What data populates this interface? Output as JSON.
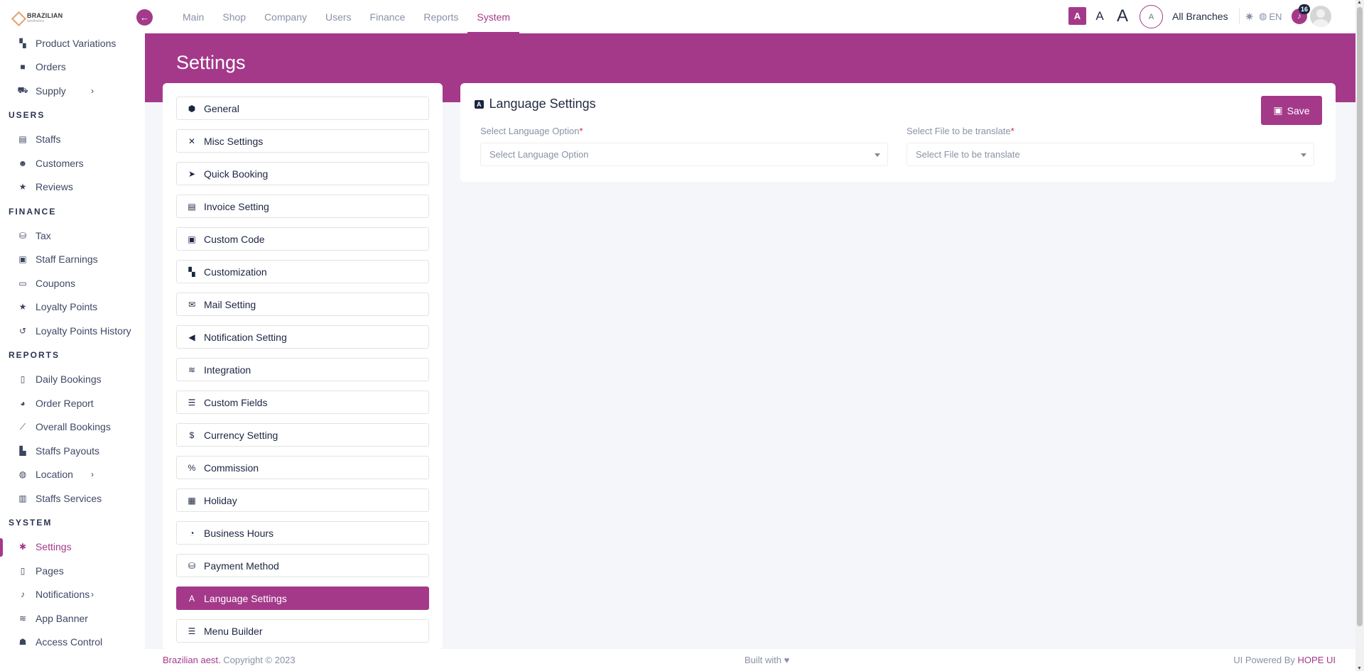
{
  "brand": {
    "name": "BRAZILIAN",
    "tagline": "aesthetics"
  },
  "sidebar": {
    "items": [
      {
        "type": "item",
        "label": "Product Variations",
        "icon": "product-variations-icon",
        "glyph": "▚"
      },
      {
        "type": "item",
        "label": "Orders",
        "icon": "shopping-bag-icon",
        "glyph": "■"
      },
      {
        "type": "item",
        "label": "Supply",
        "icon": "truck-icon",
        "glyph": "⛟",
        "chevron": true
      },
      {
        "type": "section",
        "label": "USERS"
      },
      {
        "type": "item",
        "label": "Staffs",
        "icon": "id-card-icon",
        "glyph": "▤"
      },
      {
        "type": "item",
        "label": "Customers",
        "icon": "users-icon",
        "glyph": "☻"
      },
      {
        "type": "item",
        "label": "Reviews",
        "icon": "star-icon",
        "glyph": "★"
      },
      {
        "type": "section",
        "label": "FINANCE"
      },
      {
        "type": "item",
        "label": "Tax",
        "icon": "tax-icon",
        "glyph": "⛁"
      },
      {
        "type": "item",
        "label": "Staff Earnings",
        "icon": "money-icon",
        "glyph": "▣"
      },
      {
        "type": "item",
        "label": "Coupons",
        "icon": "ticket-icon",
        "glyph": "▭"
      },
      {
        "type": "item",
        "label": "Loyalty Points",
        "icon": "star-icon",
        "glyph": "★"
      },
      {
        "type": "item",
        "label": "Loyalty Points History",
        "icon": "history-icon",
        "glyph": "↺"
      },
      {
        "type": "section",
        "label": "REPORTS"
      },
      {
        "type": "item",
        "label": "Daily Bookings",
        "icon": "file-icon",
        "glyph": "▯"
      },
      {
        "type": "item",
        "label": "Order Report",
        "icon": "pie-chart-icon",
        "glyph": "◕"
      },
      {
        "type": "item",
        "label": "Overall Bookings",
        "icon": "line-chart-icon",
        "glyph": "⟋"
      },
      {
        "type": "item",
        "label": "Staffs Payouts",
        "icon": "bar-chart-icon",
        "glyph": "▙"
      },
      {
        "type": "item",
        "label": "Location",
        "icon": "globe-icon",
        "glyph": "◍",
        "chevron": true
      },
      {
        "type": "item",
        "label": "Staffs Services",
        "icon": "clipboard-icon",
        "glyph": "▥"
      },
      {
        "type": "section",
        "label": "SYSTEM"
      },
      {
        "type": "item",
        "label": "Settings",
        "icon": "gear-icon",
        "glyph": "✱",
        "active": true
      },
      {
        "type": "item",
        "label": "Pages",
        "icon": "file-icon",
        "glyph": "▯"
      },
      {
        "type": "item",
        "label": "Notifications",
        "icon": "bell-icon",
        "glyph": "♪",
        "chevron": true
      },
      {
        "type": "item",
        "label": "App Banner",
        "icon": "sliders-icon",
        "glyph": "≋"
      },
      {
        "type": "item",
        "label": "Access Control",
        "icon": "user-lock-icon",
        "glyph": "☗"
      }
    ]
  },
  "topbar": {
    "menu": [
      {
        "label": "Main"
      },
      {
        "label": "Shop"
      },
      {
        "label": "Company"
      },
      {
        "label": "Users"
      },
      {
        "label": "Finance"
      },
      {
        "label": "Reports"
      },
      {
        "label": "System",
        "active": true
      }
    ],
    "font_small": "A",
    "font_medium": "A",
    "font_large": "A",
    "avatar_initial": "A",
    "branch": "All Branches",
    "language": "EN",
    "notification_count": "16"
  },
  "page": {
    "title": "Settings"
  },
  "settings_menu": [
    {
      "label": "General",
      "icon": "cube-icon",
      "glyph": "⬢"
    },
    {
      "label": "Misc Settings",
      "icon": "tools-icon",
      "glyph": "✕"
    },
    {
      "label": "Quick Booking",
      "icon": "paper-plane-icon",
      "glyph": "➤"
    },
    {
      "label": "Invoice Setting",
      "icon": "invoice-icon",
      "glyph": "▤"
    },
    {
      "label": "Custom Code",
      "icon": "file-code-icon",
      "glyph": "▣"
    },
    {
      "label": "Customization",
      "icon": "palette-icon",
      "glyph": "▚"
    },
    {
      "label": "Mail Setting",
      "icon": "envelope-icon",
      "glyph": "✉"
    },
    {
      "label": "Notification Setting",
      "icon": "bullhorn-icon",
      "glyph": "◀"
    },
    {
      "label": "Integration",
      "icon": "sliders-icon",
      "glyph": "≋"
    },
    {
      "label": "Custom Fields",
      "icon": "list-icon",
      "glyph": "☰"
    },
    {
      "label": "Currency Setting",
      "icon": "dollar-icon",
      "glyph": "$"
    },
    {
      "label": "Commission",
      "icon": "percent-icon",
      "glyph": "%"
    },
    {
      "label": "Holiday",
      "icon": "calendar-check-icon",
      "glyph": "▦"
    },
    {
      "label": "Business Hours",
      "icon": "clock-icon",
      "glyph": "◔"
    },
    {
      "label": "Payment Method",
      "icon": "coins-icon",
      "glyph": "⛁"
    },
    {
      "label": "Language Settings",
      "icon": "language-icon",
      "glyph": "A",
      "active": true
    },
    {
      "label": "Menu Builder",
      "icon": "list-icon",
      "glyph": "☰"
    }
  ],
  "language_settings": {
    "title": "Language Settings",
    "title_glyph": "A",
    "save_label": "Save",
    "language_label": "Select Language Option",
    "language_placeholder": "Select Language Option",
    "file_label": "Select File to be translate",
    "file_placeholder": "Select File to be translate",
    "required_mark": "*"
  },
  "footer": {
    "brand": "Brazilian aest.",
    "copyright": " Copyright © 2023",
    "built_with": "Built with ♥",
    "powered_by": "UI Powered By ",
    "powered_brand": "HOPE UI"
  },
  "colors": {
    "accent": "#a4398a",
    "dark": "#1a2540",
    "muted": "#8a92a6"
  }
}
